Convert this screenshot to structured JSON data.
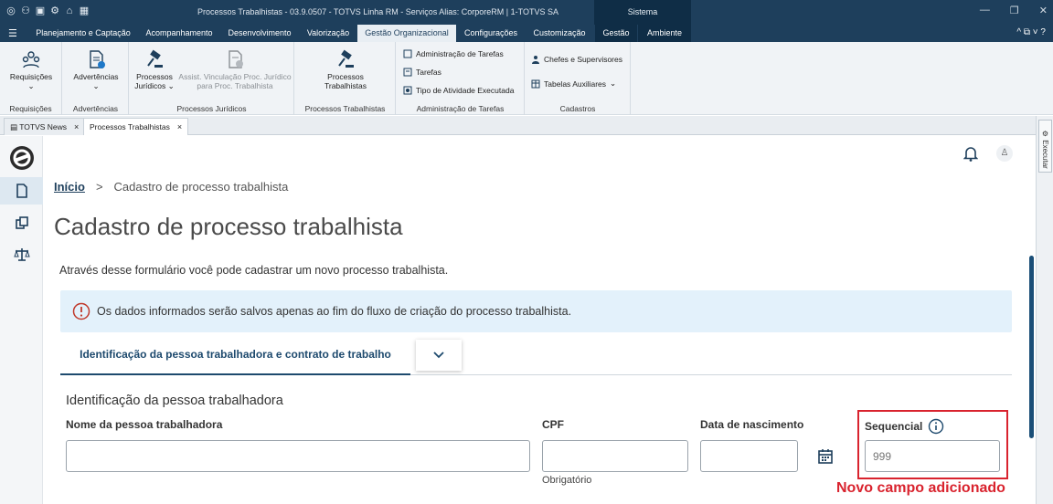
{
  "titlebar": {
    "title": "Processos Trabalhistas - 03.9.0507 - TOTVS Linha RM - Serviços  Alias: CorporeRM | 1-TOTVS SA",
    "system_tab": "Sistema",
    "win_minimize": "—",
    "win_restore": "❐",
    "win_close": "✕"
  },
  "menubar": {
    "tabs": [
      "Planejamento e Captação",
      "Acompanhamento",
      "Desenvolvimento",
      "Valorização",
      "Gestão Organizacional",
      "Configurações",
      "Customização",
      "Gestão",
      "Ambiente"
    ],
    "right_controls": "^ ⧉ ˅ ?"
  },
  "ribbon": {
    "groups": [
      {
        "label": "Requisições",
        "button": "Requisições"
      },
      {
        "label": "Advertências",
        "button": "Advertências"
      },
      {
        "label": "Processos Jurídicos",
        "buttons": [
          "Processos Jurídicos",
          "Assist. Vinculação Proc. Jurídico para Proc. Trabalhista"
        ]
      },
      {
        "label": "Processos Trabalhistas",
        "button": "Processos Trabalhistas"
      },
      {
        "label": "Administração de Tarefas",
        "items": [
          "Administração de Tarefas",
          "Tarefas",
          "Tipo de Atividade Executada"
        ]
      },
      {
        "label": "Cadastros",
        "items": [
          "Chefes e Supervisores",
          "Tabelas Auxiliares"
        ]
      }
    ]
  },
  "doctabs": [
    {
      "label": "TOTVS News"
    },
    {
      "label": "Processos Trabalhistas"
    }
  ],
  "right_strip": {
    "label": "Executar"
  },
  "breadcrumb": {
    "home": "Início",
    "sep": ">",
    "current": "Cadastro de processo trabalhista"
  },
  "page": {
    "title": "Cadastro de processo trabalhista",
    "description": "Através desse formulário você pode cadastrar um novo processo trabalhista.",
    "alert": "Os dados informados serão salvos apenas ao fim do fluxo de criação do processo trabalhista.",
    "active_tab": "Identificação da pessoa trabalhadora e contrato de trabalho",
    "section_title": "Identificação da pessoa trabalhadora"
  },
  "form": {
    "name_label": "Nome da pessoa trabalhadora",
    "cpf_label": "CPF",
    "cpf_hint": "Obrigatório",
    "birth_label": "Data de nascimento",
    "seq_label": "Sequencial",
    "seq_placeholder": "999"
  },
  "annotation": {
    "text": "Novo campo adicionado",
    "color": "#d9232e"
  },
  "colors": {
    "primary": "#1e3f5c",
    "alert_bg": "#e3f1fb",
    "accent": "#1e4a6e"
  }
}
